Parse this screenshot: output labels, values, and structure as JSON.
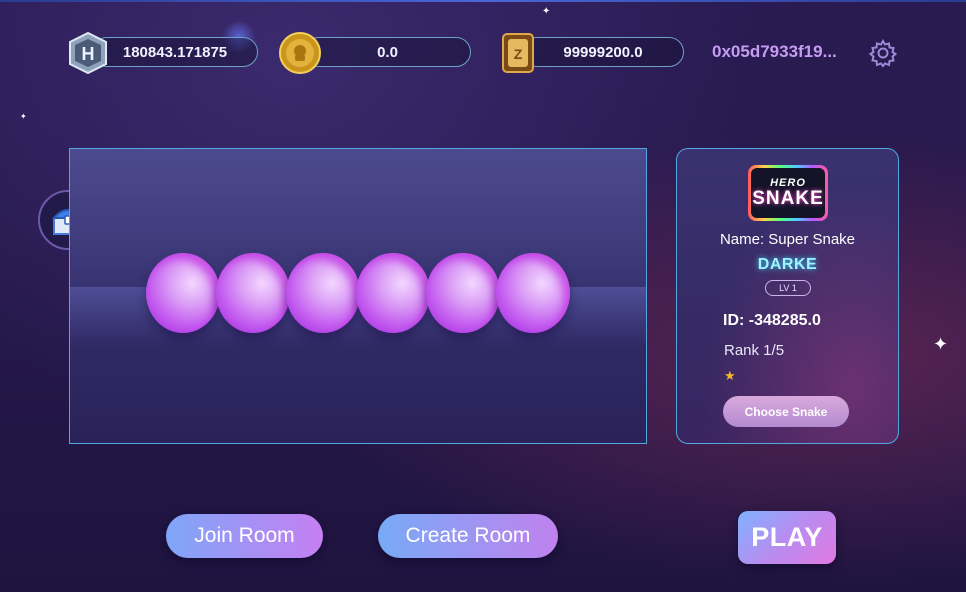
{
  "header": {
    "currencies": [
      {
        "icon": "hero-token-icon",
        "value": "180843.171875"
      },
      {
        "icon": "gold-coin-icon",
        "value": "0.0"
      },
      {
        "icon": "gold-ticket-icon",
        "value": "99999200.0"
      }
    ],
    "wallet_address": "0x05d7933f19...",
    "settings_icon": "gear-icon"
  },
  "sidebar": {
    "chest_icon": "treasure-chest-icon"
  },
  "snake_preview": {
    "segments": 6
  },
  "snake_card": {
    "logo_line1": "HERO",
    "logo_line2": "SNAKE",
    "name": "Name: Super Snake",
    "tier": "DARKE",
    "level": "LV 1",
    "id": "ID: -348285.0",
    "rank": "Rank 1/5",
    "stars": "★",
    "choose_label": "Choose Snake"
  },
  "actions": {
    "join_label": "Join Room",
    "create_label": "Create Room",
    "play_label": "PLAY"
  },
  "colors": {
    "accent_border": "#4fa8e0",
    "wallet_text": "#c59cf2",
    "tier_text": "#9ff4ff",
    "snake_body": "#c45df0"
  }
}
